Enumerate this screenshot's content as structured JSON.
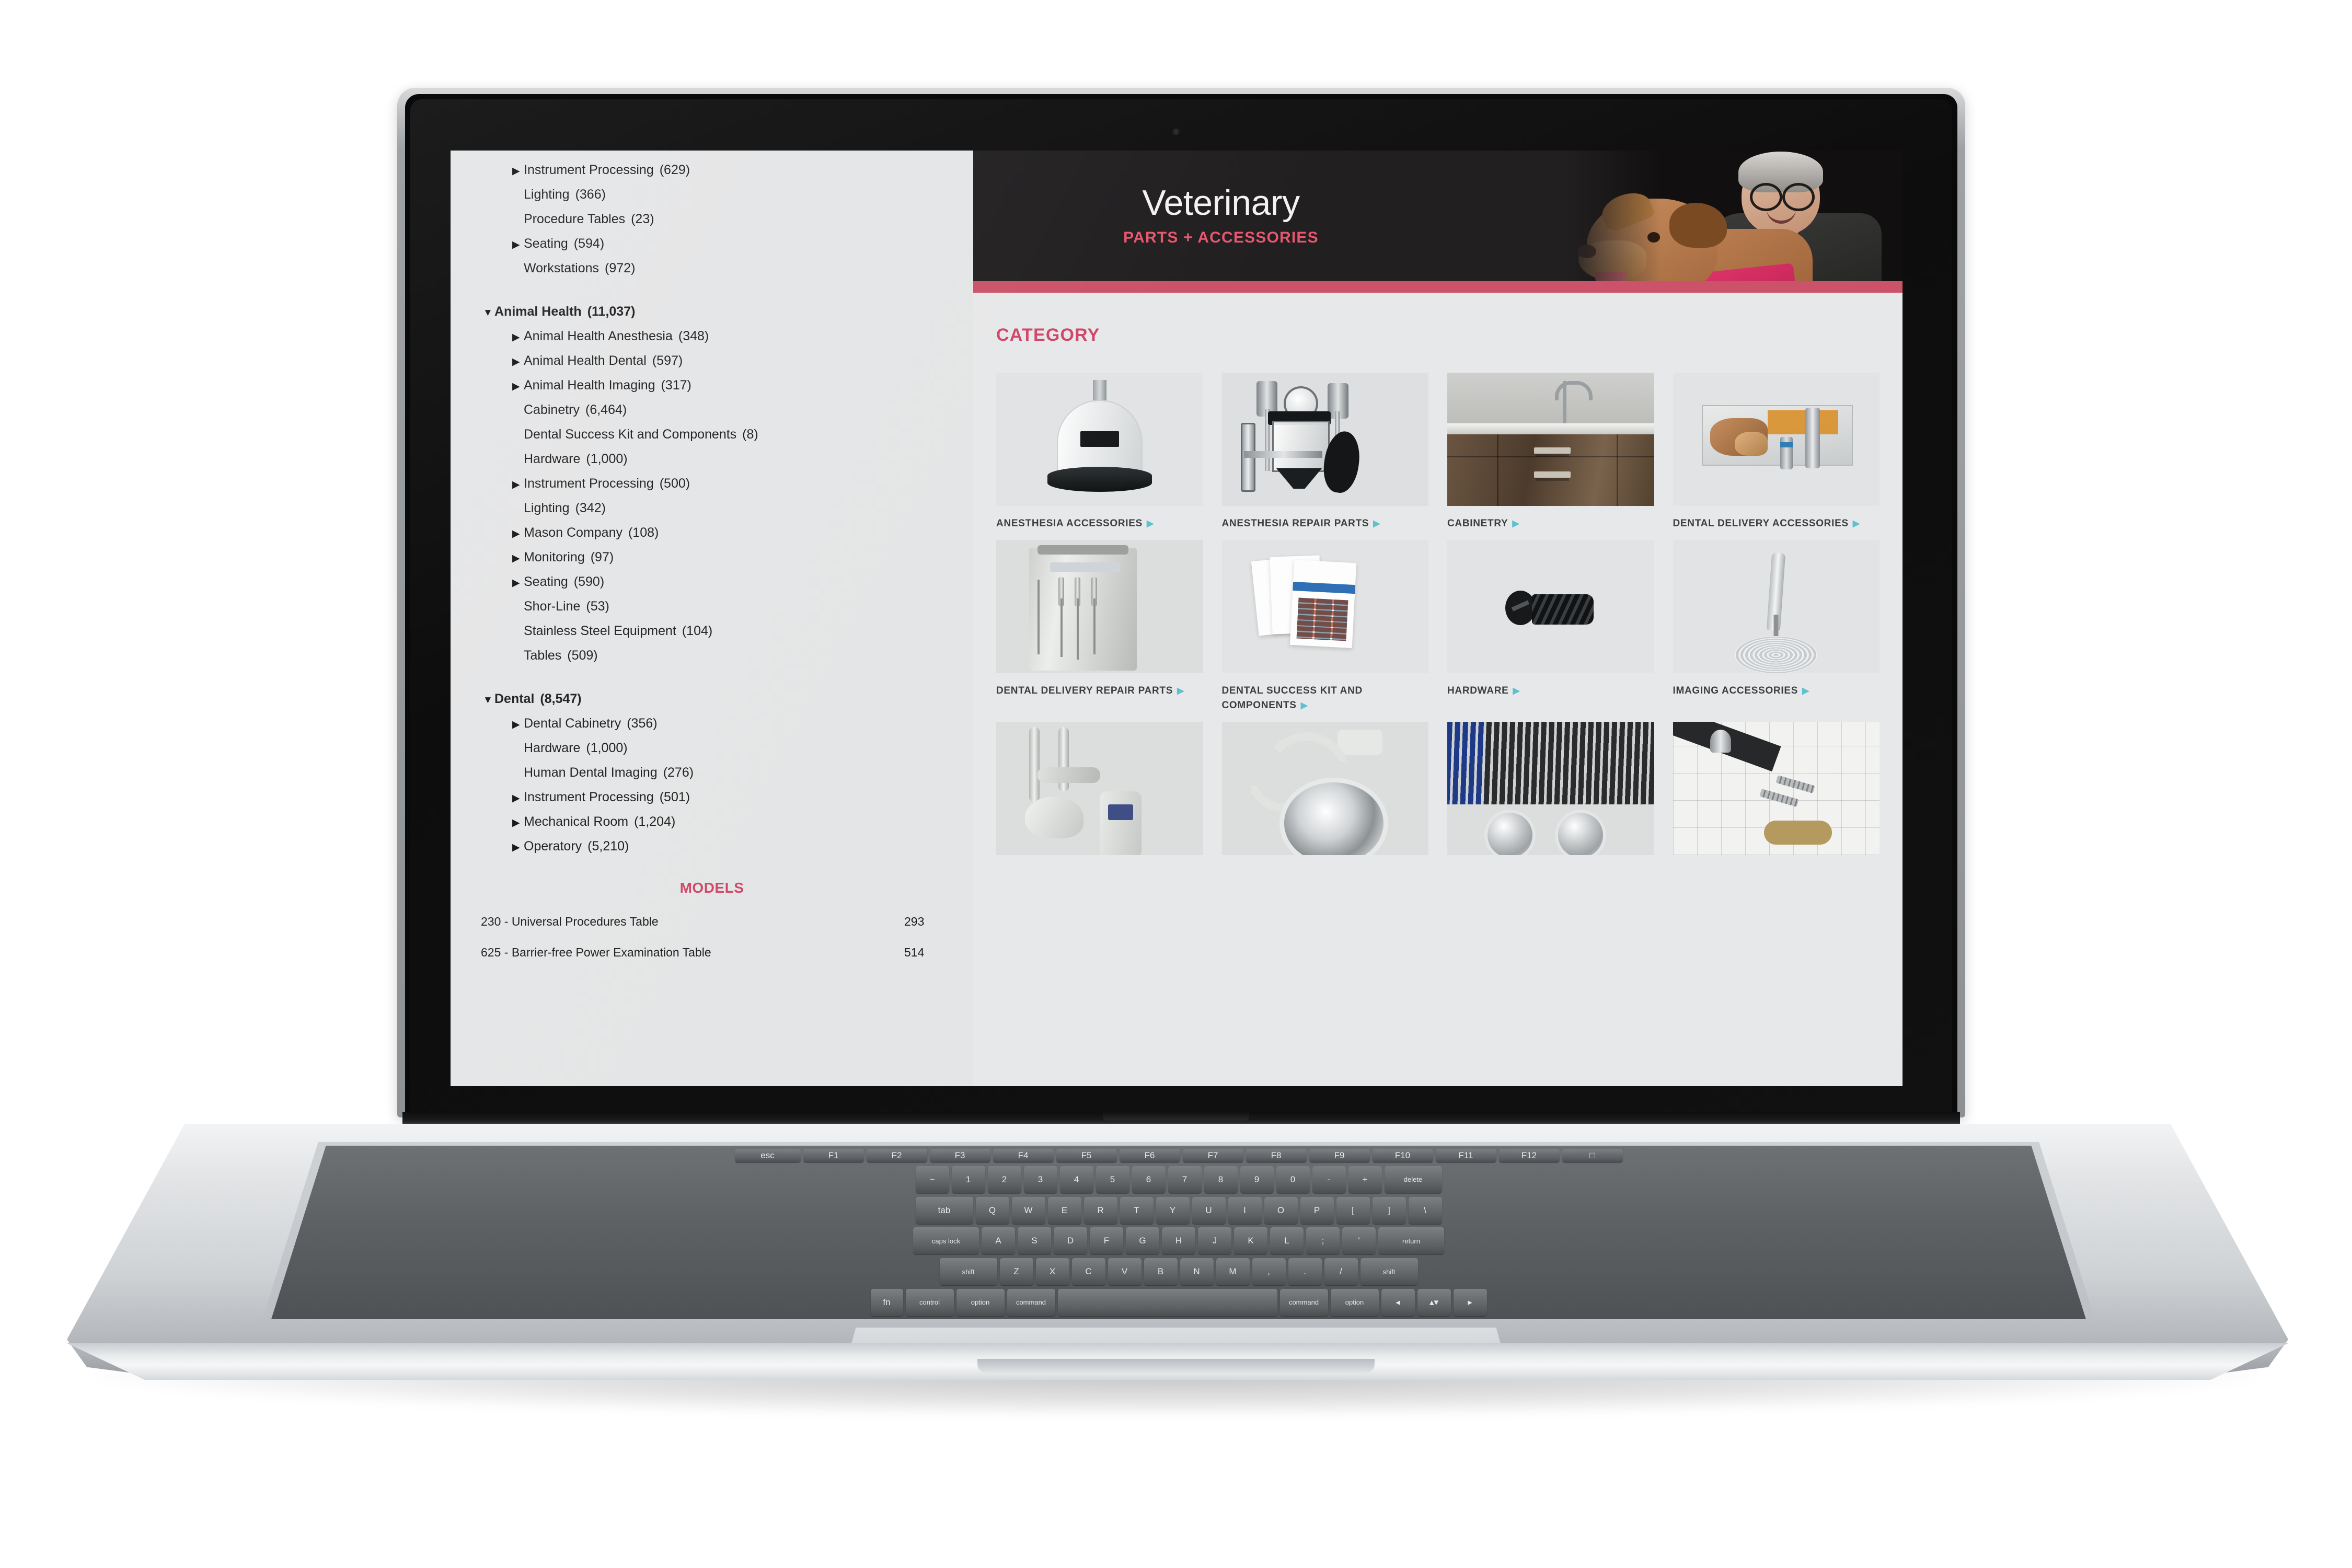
{
  "device": {
    "type": "laptop",
    "brand_style": "macbook"
  },
  "sidebar": {
    "nav": [
      {
        "label": "Instrument Processing",
        "count": "(629)",
        "level": 2,
        "toggle": "right"
      },
      {
        "label": "Lighting",
        "count": "(366)",
        "level": 2,
        "toggle": "blank"
      },
      {
        "label": "Procedure Tables",
        "count": "(23)",
        "level": 2,
        "toggle": "blank"
      },
      {
        "label": "Seating",
        "count": "(594)",
        "level": 2,
        "toggle": "right"
      },
      {
        "label": "Workstations",
        "count": "(972)",
        "level": 2,
        "toggle": "blank"
      },
      {
        "label": "Animal Health",
        "count": "(11,037)",
        "level": 1,
        "toggle": "down",
        "group": true
      },
      {
        "label": "Animal Health Anesthesia",
        "count": "(348)",
        "level": 2,
        "toggle": "right"
      },
      {
        "label": "Animal Health Dental",
        "count": "(597)",
        "level": 2,
        "toggle": "right"
      },
      {
        "label": "Animal Health Imaging",
        "count": "(317)",
        "level": 2,
        "toggle": "right"
      },
      {
        "label": "Cabinetry",
        "count": "(6,464)",
        "level": 2,
        "toggle": "blank"
      },
      {
        "label": "Dental Success Kit and Components",
        "count": "(8)",
        "level": 2,
        "toggle": "blank"
      },
      {
        "label": "Hardware",
        "count": "(1,000)",
        "level": 2,
        "toggle": "blank"
      },
      {
        "label": "Instrument Processing",
        "count": "(500)",
        "level": 2,
        "toggle": "right"
      },
      {
        "label": "Lighting",
        "count": "(342)",
        "level": 2,
        "toggle": "blank"
      },
      {
        "label": "Mason Company",
        "count": "(108)",
        "level": 2,
        "toggle": "right"
      },
      {
        "label": "Monitoring",
        "count": "(97)",
        "level": 2,
        "toggle": "right"
      },
      {
        "label": "Seating",
        "count": "(590)",
        "level": 2,
        "toggle": "right"
      },
      {
        "label": "Shor-Line",
        "count": "(53)",
        "level": 2,
        "toggle": "blank"
      },
      {
        "label": "Stainless Steel Equipment",
        "count": "(104)",
        "level": 2,
        "toggle": "blank"
      },
      {
        "label": "Tables",
        "count": "(509)",
        "level": 2,
        "toggle": "blank"
      },
      {
        "label": "Dental",
        "count": "(8,547)",
        "level": 1,
        "toggle": "down",
        "group": true
      },
      {
        "label": "Dental Cabinetry",
        "count": "(356)",
        "level": 2,
        "toggle": "right"
      },
      {
        "label": "Hardware",
        "count": "(1,000)",
        "level": 2,
        "toggle": "blank"
      },
      {
        "label": "Human Dental Imaging",
        "count": "(276)",
        "level": 2,
        "toggle": "blank"
      },
      {
        "label": "Instrument Processing",
        "count": "(501)",
        "level": 2,
        "toggle": "right"
      },
      {
        "label": "Mechanical Room",
        "count": "(1,204)",
        "level": 2,
        "toggle": "right"
      },
      {
        "label": "Operatory",
        "count": "(5,210)",
        "level": 2,
        "toggle": "right"
      }
    ],
    "models": {
      "heading": "MODELS",
      "rows": [
        {
          "name": "230 - Universal Procedures Table",
          "count": "293"
        },
        {
          "name": "625 - Barrier-free Power Examination Table",
          "count": "514"
        }
      ]
    }
  },
  "hero": {
    "title": "Veterinary",
    "subtitle": "PARTS + ACCESSORIES",
    "bar_color": "#cb5268",
    "bg_color": "#211f20"
  },
  "main": {
    "category_heading": "CATEGORY",
    "accent_color": "#cf4666",
    "tri_color": "#5fc0cf",
    "tiles": [
      {
        "caption": "ANESTHESIA ACCESSORIES",
        "tri": "▶",
        "image": "bell-jar-anesthesia-accessory"
      },
      {
        "caption": "ANESTHESIA REPAIR PARTS",
        "tri": "▶",
        "image": "anesthesia-machine-parts"
      },
      {
        "caption": "CABINETRY",
        "tri": "▶",
        "image": "wood-cabinetry-with-sink"
      },
      {
        "caption": "DENTAL DELIVERY ACCESSORIES",
        "tri": "▶",
        "image": "vetpro-dental-kit-box"
      },
      {
        "caption": "DENTAL DELIVERY REPAIR PARTS",
        "tri": "▶",
        "image": "dental-delivery-cart"
      },
      {
        "caption": "DENTAL SUCCESS KIT AND COMPONENTS",
        "tri": "▶",
        "image": "printed-brochures"
      },
      {
        "caption": "HARDWARE",
        "tri": "▶",
        "image": "black-screw"
      },
      {
        "caption": "IMAGING ACCESSORIES",
        "tri": "▶",
        "image": "imaging-wand-and-coil"
      },
      {
        "caption": "",
        "tri": "",
        "image": "dental-delivery-arm-unit"
      },
      {
        "caption": "",
        "tri": "",
        "image": "surgical-exam-light"
      },
      {
        "caption": "",
        "tri": "",
        "image": "stainless-cage-grill-bowls"
      },
      {
        "caption": "",
        "tri": "",
        "image": "technical-blueprint-hardware"
      }
    ]
  }
}
